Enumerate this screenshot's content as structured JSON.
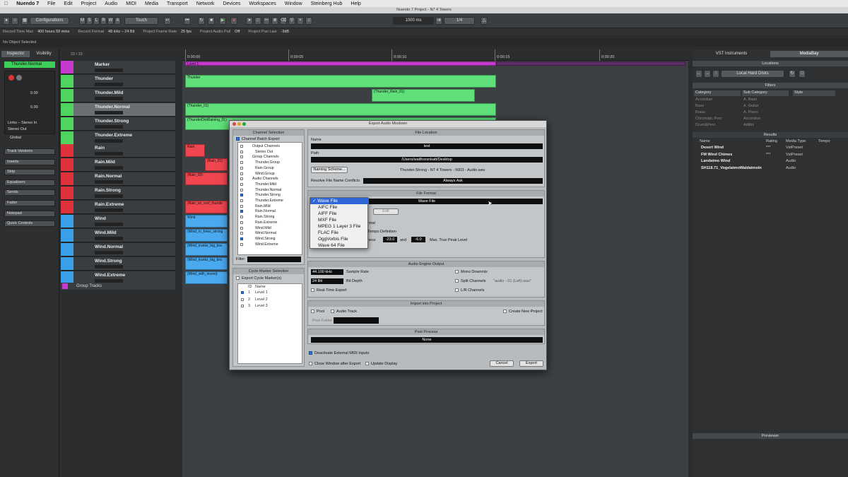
{
  "menubar": {
    "apple": "",
    "items": [
      "Nuendo 7",
      "File",
      "Edit",
      "Project",
      "Audio",
      "MIDI",
      "Media",
      "Transport",
      "Network",
      "Devices",
      "Workspaces",
      "Window",
      "Steinberg Hub",
      "Help"
    ]
  },
  "window_title": "Nuendo 7 Project - N7 4 Towers",
  "toolbar": {
    "configurations": "Configurations",
    "automation_mode": "Touch",
    "time_display": "1000 ms",
    "quantize": "1/4",
    "msrwa": [
      "M",
      "S",
      "L",
      "R",
      "W",
      "A"
    ]
  },
  "status": {
    "record_time_max_label": "Record Time Max",
    "record_time_max": "400 hours 59 mins",
    "record_format_label": "Record Format",
    "record_format": "48 kHz – 24 Bit",
    "frame_rate_label": "Project Frame Rate",
    "frame_rate": "25 fps",
    "pull_label": "Project Audio Pull",
    "pull": "Off",
    "pan_law_label": "Project Pan Law",
    "pan_law": "-3dB"
  },
  "info_line": "No Object Selected",
  "inspector": {
    "tab_inspector": "Inspector",
    "tab_visibility": "Visibility",
    "track_name": "Thunder.Normal",
    "val1": "0.00",
    "val2": "0.00",
    "routing_in": "Links – Stereo In",
    "routing_out": "Stereo Out",
    "global": "Global",
    "sections": [
      "Track Versions",
      "Inserts",
      "Strip",
      "Equalizers",
      "Sends",
      "Fader",
      "Notepad",
      "Quick Controls"
    ]
  },
  "tracklist": {
    "count": "22 / 22",
    "tracks": [
      {
        "name": "Marker",
        "color": "#c63ad0"
      },
      {
        "name": "Thunder",
        "color": "#4fd45f"
      },
      {
        "name": "Thunder.Mild",
        "color": "#4fd45f"
      },
      {
        "name": "Thunder.Normal",
        "color": "#4fd45f"
      },
      {
        "name": "Thunder.Strong",
        "color": "#4fd45f"
      },
      {
        "name": "Thunder.Extreme",
        "color": "#4fd45f"
      },
      {
        "name": "Rain",
        "color": "#e0323c"
      },
      {
        "name": "Rain.Mild",
        "color": "#e0323c"
      },
      {
        "name": "Rain.Normal",
        "color": "#e0323c"
      },
      {
        "name": "Rain.Strong",
        "color": "#e0323c"
      },
      {
        "name": "Rain.Extreme",
        "color": "#e0323c"
      },
      {
        "name": "Wind",
        "color": "#3aa0e8"
      },
      {
        "name": "Wind.Mild",
        "color": "#3aa0e8"
      },
      {
        "name": "Wind.Normal",
        "color": "#3aa0e8"
      },
      {
        "name": "Wind.Strong",
        "color": "#3aa0e8"
      },
      {
        "name": "Wind.Extreme",
        "color": "#3aa0e8"
      }
    ],
    "group_tracks": "Group Tracks"
  },
  "ruler": {
    "ticks": [
      "0:00:00",
      "0:00:05",
      "0:00:10",
      "0:00:15",
      "0:00:20"
    ]
  },
  "clips": {
    "level": "Level 1",
    "thunder": "Thunder",
    "thunder_mild": "(Thunder_Rain_01)",
    "thunder_normal": "(Thunder_01)",
    "thunder_strong": "(ThunderDistRaining_01)",
    "rain": "Rain",
    "rain_mild": "(Rain_01)",
    "rain_normal": "(Rain_02)",
    "rain_extreme": "(Rain_on_roof_thunde",
    "wind": "Wind",
    "wind_mild": "(Wind_in_trees_strong",
    "wind_normal": "(Wind_trunks_big_bra",
    "wind_strong": "(Wind_trunks_big_bra",
    "wind_extreme": "(Wind_with_invent)"
  },
  "rightpanel": {
    "tab_vst": "VST Instruments",
    "tab_mediabay": "MediaBay",
    "locations": "Locations",
    "location_value": "Local Hard Disks",
    "filters": "Filters",
    "col_category": "Category",
    "col_subcategory": "Sub Category",
    "col_style": "Style",
    "categories": [
      "Accordian",
      "Bass",
      "Brass",
      "Chromatic Perc",
      "Drum&Perc"
    ],
    "subcategories": [
      "A. Bass",
      "A. Guitar",
      "A. Piano",
      "Accordion",
      "Adlibs"
    ],
    "results": "Results",
    "res_cols": [
      "Name",
      "Rating",
      "Media Type",
      "Tempo"
    ],
    "rows": [
      {
        "name": "Desert Wind",
        "rating": "***",
        "type": "VstPreset"
      },
      {
        "name": "FM Wind Chimes",
        "rating": "***",
        "type": "VstPreset"
      },
      {
        "name": "Landatmo Wind",
        "rating": "",
        "type": "Audio"
      },
      {
        "name": "SH118.71_VogelatmoWaldatmoIn",
        "rating": "",
        "type": "Audio"
      }
    ],
    "previewer": "Previewer"
  },
  "dialog": {
    "title": "Export Audio Mixdown",
    "channel_selection": "Channel Selection",
    "channel_batch_export": "Channel Batch Export",
    "channels": [
      {
        "label": "Output Channels",
        "indent": 0,
        "checked": false
      },
      {
        "label": "Stereo Out",
        "indent": 1,
        "checked": false
      },
      {
        "label": "Group Channels",
        "indent": 0,
        "checked": false
      },
      {
        "label": "Thunder.Group",
        "indent": 1,
        "checked": false
      },
      {
        "label": "Rain.Group",
        "indent": 1,
        "checked": false
      },
      {
        "label": "Wind.Group",
        "indent": 1,
        "checked": false
      },
      {
        "label": "Audio Channels",
        "indent": 0,
        "checked": false
      },
      {
        "label": "Thunder.Mild",
        "indent": 1,
        "checked": false
      },
      {
        "label": "Thunder.Normal",
        "indent": 1,
        "checked": false
      },
      {
        "label": "Thunder.Strong",
        "indent": 1,
        "checked": true
      },
      {
        "label": "Thunder.Extreme",
        "indent": 1,
        "checked": false
      },
      {
        "label": "Rain.Mild",
        "indent": 1,
        "checked": false
      },
      {
        "label": "Rain.Normal",
        "indent": 1,
        "checked": true
      },
      {
        "label": "Rain.Strong",
        "indent": 1,
        "checked": false
      },
      {
        "label": "Rain.Extreme",
        "indent": 1,
        "checked": false
      },
      {
        "label": "Wind.Mild",
        "indent": 1,
        "checked": false
      },
      {
        "label": "Wind.Normal",
        "indent": 1,
        "checked": false
      },
      {
        "label": "Wind.Strong",
        "indent": 1,
        "checked": true
      },
      {
        "label": "Wind.Extreme",
        "indent": 1,
        "checked": false
      }
    ],
    "filter_label": "Filter",
    "cycle_marker_selection": "Cycle Marker Selection",
    "export_cycle_markers": "Export Cycle Marker(s)",
    "cm_col_id": "ID",
    "cm_col_name": "Name",
    "cycle_markers": [
      {
        "id": "1",
        "name": "Level 1",
        "checked": true
      },
      {
        "id": "2",
        "name": "Level 2",
        "checked": false
      },
      {
        "id": "3",
        "name": "Level 3",
        "checked": false
      }
    ],
    "file_location": "File Location",
    "name_label": "Name",
    "name_value": "test",
    "path_label": "Path",
    "path_value": "/Users/walthorsnkatt/Desktop",
    "naming_scheme_button": "Naming Scheme...",
    "naming_preview": "Thunder.Strong - N7 4 Towers - 0003 - Audio.wav",
    "resolve_label": "Resolve File Name Conflicts",
    "resolve_value": "Always Ask",
    "file_format": "File Format",
    "format_value": "Wave File",
    "format_options": [
      "Wave File",
      "AIFC File",
      "AIFF File",
      "MXF File",
      "MPEG 1 Layer 3 File",
      "FLAC File",
      "OggVorbis File",
      "Wave 64 File"
    ],
    "edit_button": "Edit",
    "partial_text_1": "rmat",
    "partial_text_2": "Tempo Definition",
    "partial_text_3": "ness",
    "loudness_value": "-23.0",
    "and_text": "and",
    "true_peak_value": "-6.0",
    "true_peak_label": "Max. True Peak Level",
    "audio_engine_output": "Audio Engine Output",
    "sample_rate_value": "44.100 kHz",
    "sample_rate_label": "Sample Rate",
    "bit_depth_value": "24 Bit",
    "bit_depth_label": "Bit Depth",
    "realtime_export": "Real-Time Export",
    "mono_downmix": "Mono Downmix",
    "split_channels": "Split Channels",
    "split_hint": "\"audio - 01 (Left).wav\"",
    "lr_channels": "L/R Channels",
    "import_into_project": "Import into Project",
    "pool": "Pool",
    "audio_track": "Audio Track",
    "create_new_project": "Create New Project",
    "pool_folder": "Pool Folder",
    "post_process": "Post Process",
    "post_value": "None",
    "deactivate_midi": "Deactivate External MIDI Inputs",
    "close_after_export": "Close Window after Export",
    "update_display": "Update Display",
    "cancel": "Cancel",
    "export": "Export"
  }
}
